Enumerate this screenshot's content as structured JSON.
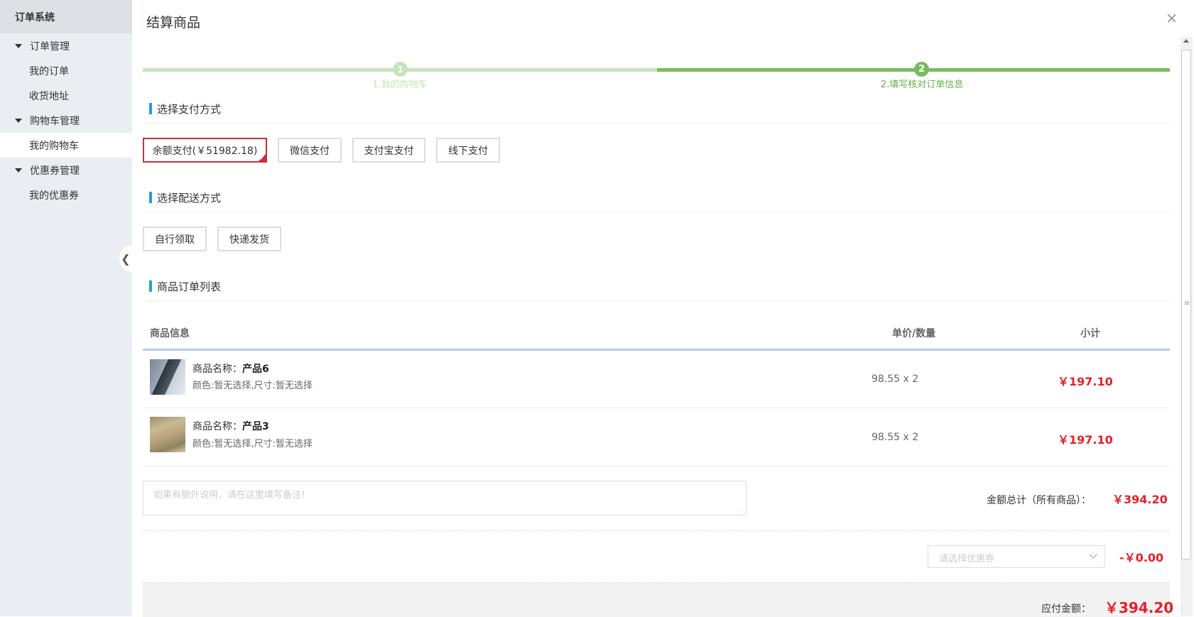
{
  "sidebar": {
    "title": "订单系统",
    "groups": [
      {
        "label": "订单管理",
        "items": [
          "我的订单",
          "收货地址"
        ]
      },
      {
        "label": "购物车管理",
        "items": [
          "我的购物车"
        ]
      },
      {
        "label": "优惠券管理",
        "items": [
          "我的优惠券"
        ]
      }
    ],
    "active_item": "我的购物车",
    "collapse_icon": "chevron-left-icon"
  },
  "dialog": {
    "title": "结算商品",
    "close_icon": "close-icon"
  },
  "steps": [
    {
      "number": "1",
      "label": "1.我的购物车",
      "state": "done"
    },
    {
      "number": "2",
      "label": "2.填写核对订单信息",
      "state": "current"
    }
  ],
  "payment": {
    "heading": "选择支付方式",
    "options": [
      "余额支付(￥51982.18)",
      "微信支付",
      "支付宝支付",
      "线下支付"
    ],
    "selected_index": 0
  },
  "delivery": {
    "heading": "选择配送方式",
    "options": [
      "自行领取",
      "快递发货"
    ]
  },
  "order_list": {
    "heading": "商品订单列表",
    "columns": [
      "商品信息",
      "单价/数量",
      "小计"
    ],
    "rows": [
      {
        "name_prefix": "商品名称：",
        "name": "产品6",
        "attrs": "颜色:暂无选择,尺寸:暂无选择",
        "price_qty": "98.55 x 2",
        "subtotal": "￥197.10"
      },
      {
        "name_prefix": "商品名称：",
        "name": "产品3",
        "attrs": "颜色:暂无选择,尺寸:暂无选择",
        "price_qty": "98.55 x 2",
        "subtotal": "￥197.10"
      }
    ]
  },
  "remark": {
    "placeholder": "如果有额外说明，请在这里填写备注！"
  },
  "summary": {
    "total_label": "金额总计（所有商品）：",
    "total_value": "￥394.20",
    "coupon_placeholder": "请选择优惠券",
    "coupon_value": "-￥0.00",
    "payable_label": "应付金额：",
    "payable_value": "￥394.20"
  },
  "colors": {
    "accent_red": "#e4202b",
    "selected_border": "#c8303a",
    "step_done": "#c6e4b9",
    "step_current": "#79bb5f",
    "section_marker": "#1ea1df"
  }
}
